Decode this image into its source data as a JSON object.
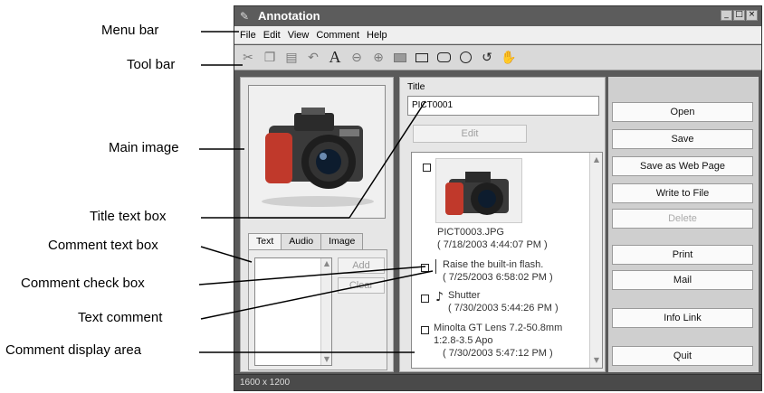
{
  "callouts": {
    "menu_bar": "Menu bar",
    "tool_bar": "Tool bar",
    "main_image": "Main image",
    "title_text_box": "Title text box",
    "comment_text_box": "Comment text box",
    "comment_check_box": "Comment check box",
    "text_comment": "Text comment",
    "comment_display_area": "Comment display area"
  },
  "window": {
    "title": "Annotation",
    "menu": [
      "File",
      "Edit",
      "View",
      "Comment",
      "Help"
    ],
    "toolbar_icons": [
      "cut-icon",
      "copy-icon",
      "paste-icon",
      "undo-icon",
      "text-tool-icon",
      "zoom-out-icon",
      "zoom-in-icon",
      "filled-rect-icon",
      "rect-icon",
      "rounded-rect-icon",
      "ellipse-icon",
      "freehand-icon",
      "hand-icon"
    ]
  },
  "left": {
    "tabs": [
      "Text",
      "Audio",
      "Image"
    ],
    "add_label": "Add",
    "clear_label": "Clear"
  },
  "middle": {
    "title_label": "Title",
    "title_value": "PICT0001",
    "edit_label": "Edit",
    "entries": [
      {
        "line1": "PICT0003.JPG",
        "line2": "( 7/18/2003 4:44:07 PM )"
      },
      {
        "line1": "Raise the built-in flash.",
        "line2": "( 7/25/2003 6:58:02 PM )"
      },
      {
        "line1": "Shutter",
        "line2": "( 7/30/2003 5:44:26 PM )"
      },
      {
        "line1": "Minolta GT Lens 7.2-50.8mm",
        "line2": "1:2.8-3.5 Apo",
        "line3": "( 7/30/2003 5:47:12 PM )"
      }
    ]
  },
  "right": {
    "buttons": {
      "open": "Open",
      "save": "Save",
      "save_web": "Save as Web Page",
      "write_file": "Write to File",
      "delete": "Delete",
      "print": "Print",
      "mail": "Mail",
      "info_link": "Info Link",
      "quit": "Quit"
    }
  },
  "status": {
    "dimensions": "1600 x 1200"
  }
}
